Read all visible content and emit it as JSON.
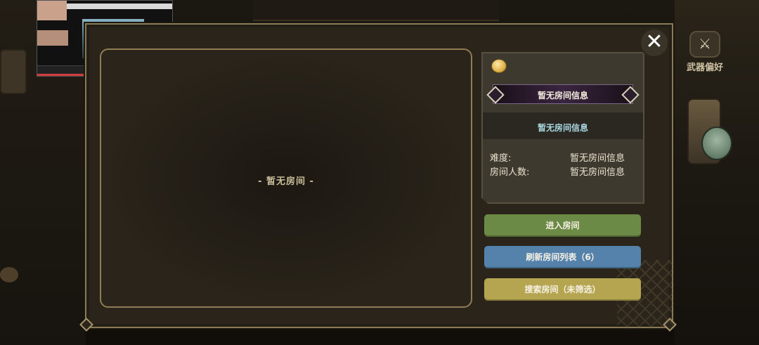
{
  "side": {
    "weapon_pref_label": "武器偏好",
    "weapon_pref_icon": "weapon-badge-icon"
  },
  "room_list": {
    "empty_text": "- 暂无房间 -"
  },
  "room_info": {
    "coin_icon": "coin-icon",
    "room_name": "暂无房间信息",
    "room_subtitle": "暂无房间信息",
    "difficulty_label": "难度:",
    "difficulty_value": "暂无房间信息",
    "players_label": "房间人数:",
    "players_value": "暂无房间信息"
  },
  "buttons": {
    "enter": "进入房间",
    "refresh": "刷新房间列表（6）",
    "search": "搜索房间（未筛选）",
    "close_glyph": "✕"
  },
  "colors": {
    "enter": "#6b8a45",
    "refresh": "#5582ab",
    "search": "#b5a450",
    "panel_border": "#8a7a56"
  }
}
